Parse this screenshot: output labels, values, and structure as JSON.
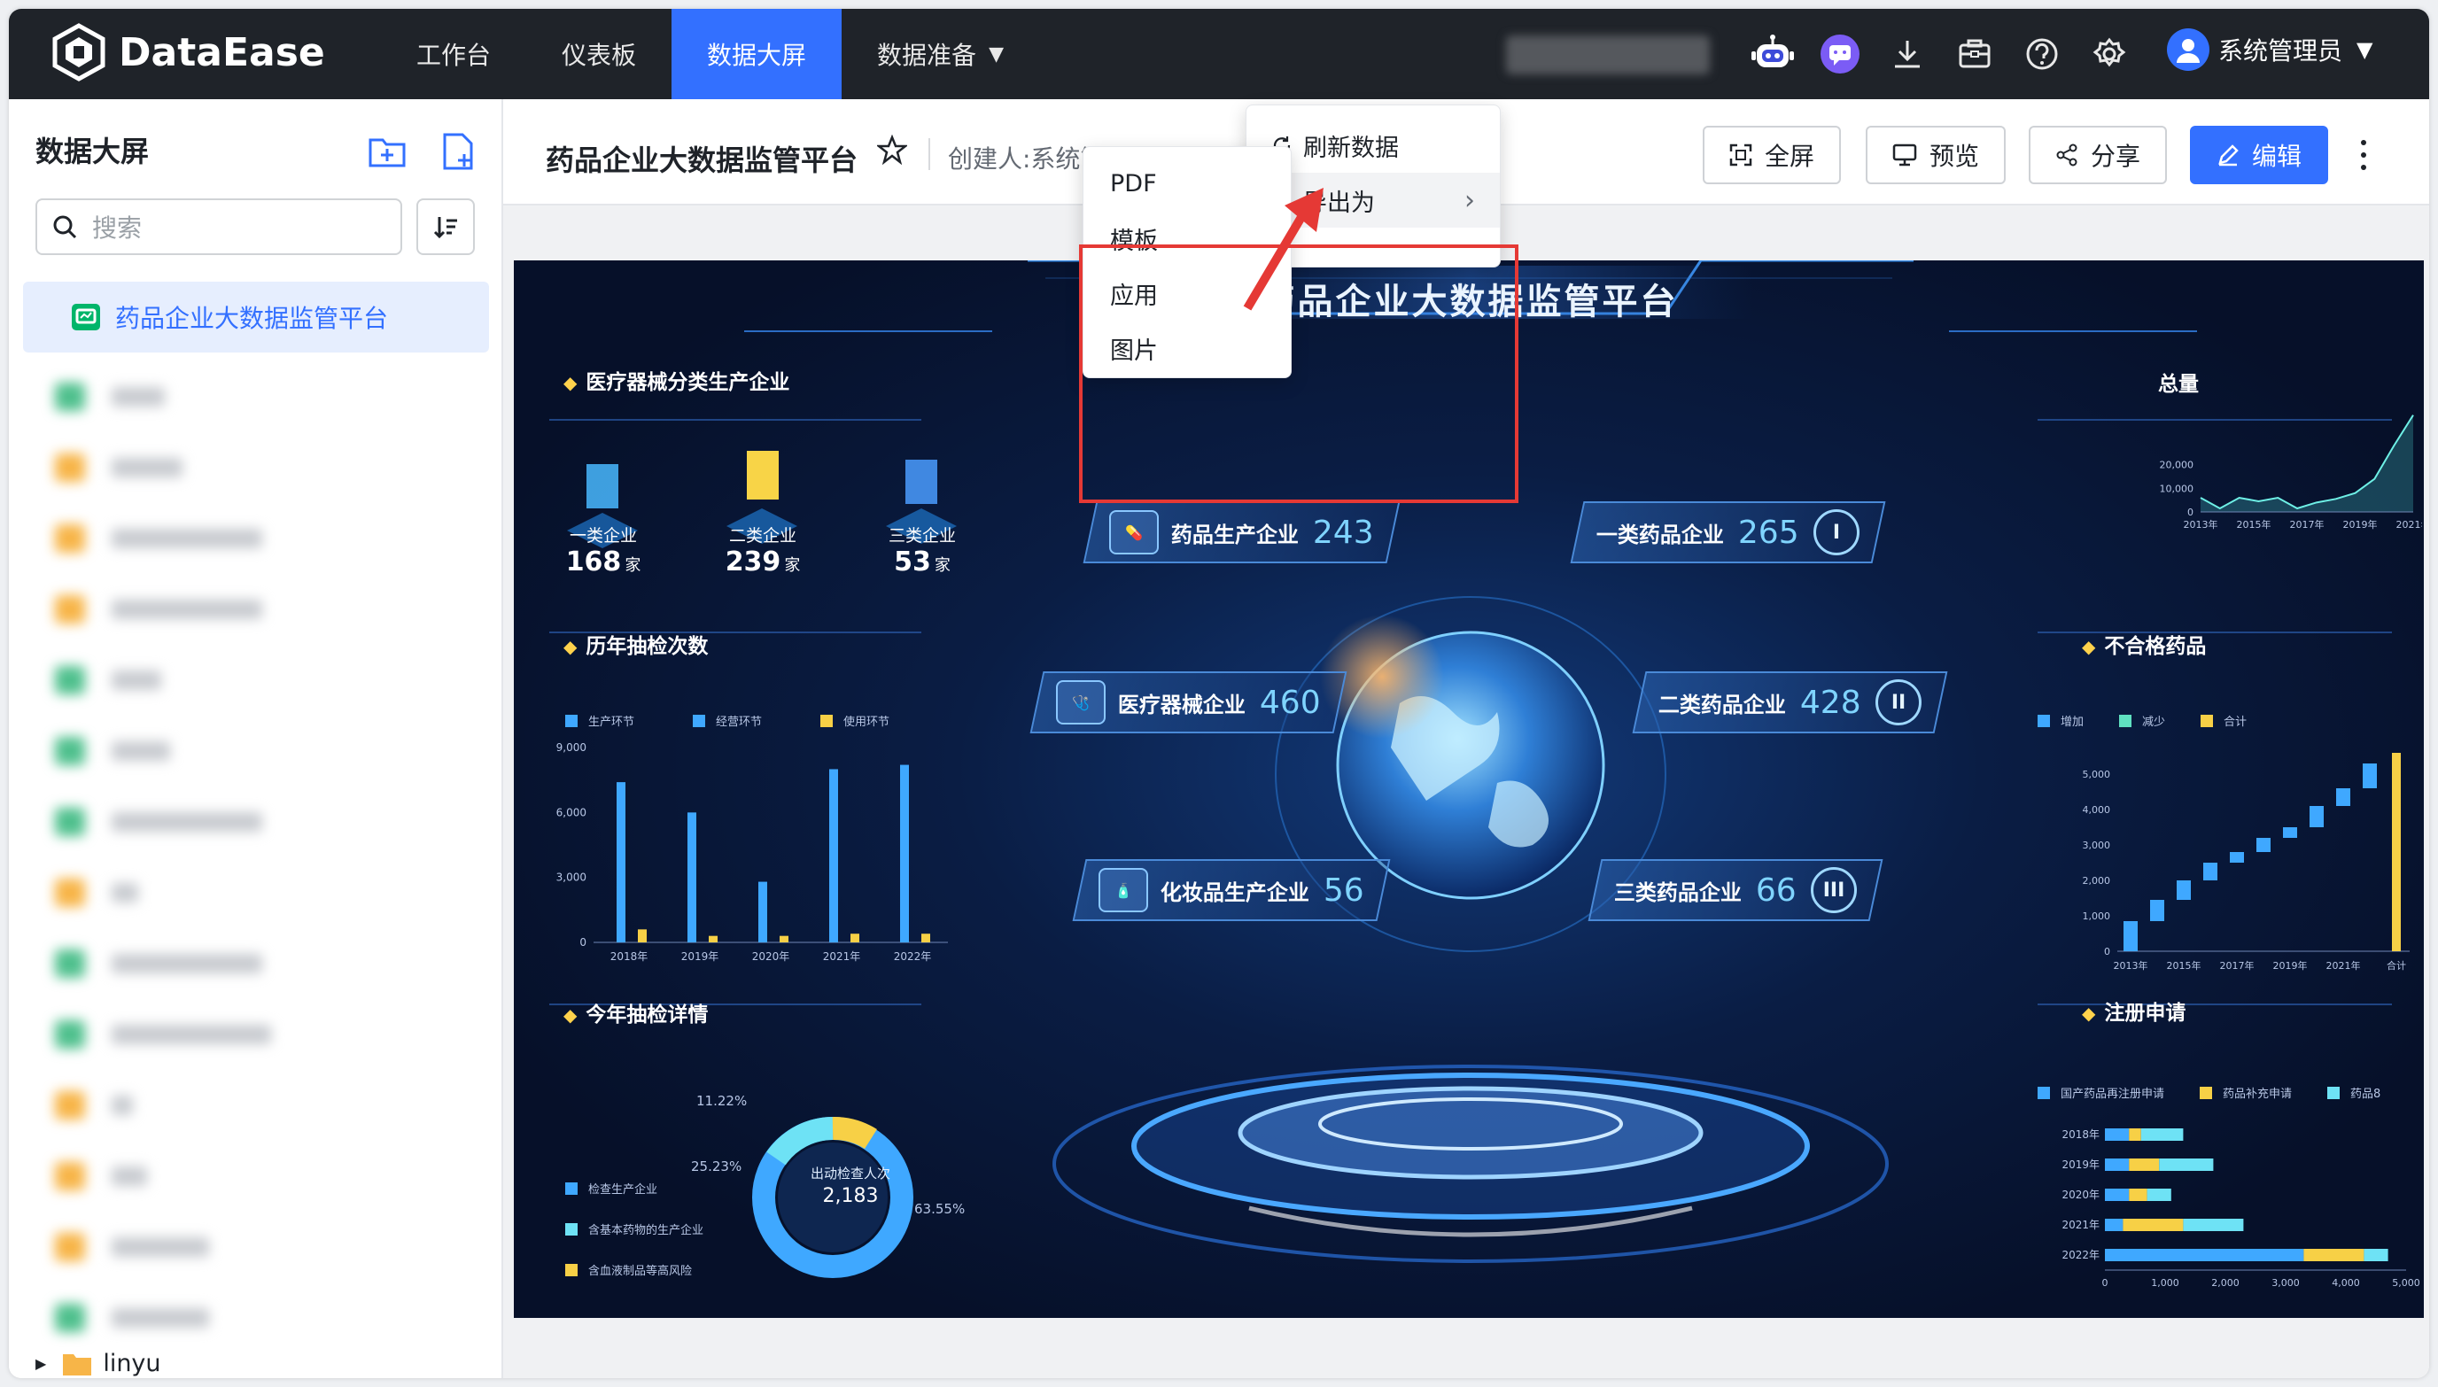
{
  "app": {
    "name": "DataEase"
  },
  "nav": [
    {
      "label": "工作台",
      "active": false
    },
    {
      "label": "仪表板",
      "active": false
    },
    {
      "label": "数据大屏",
      "active": true
    },
    {
      "label": "数据准备",
      "active": false,
      "caret": "▼"
    }
  ],
  "top_icons": [
    "robot-icon",
    "chat-icon",
    "download-icon",
    "template-icon",
    "help-icon",
    "settings-icon"
  ],
  "user": {
    "name": "系统管理员",
    "caret": "▼"
  },
  "sidebar": {
    "title": "数据大屏",
    "search_placeholder": "搜索",
    "active_item": "药品企业大数据监管平台",
    "last_item": "linyu"
  },
  "header": {
    "title": "药品企业大数据监管平台",
    "creator": "创建人:系统管理员",
    "buttons": {
      "fullscreen": "全屏",
      "preview": "预览",
      "share": "分享",
      "edit": "编辑"
    }
  },
  "more_menu": {
    "refresh": "刷新数据",
    "export": "导出为",
    "export_arrow": "›"
  },
  "export_submenu": [
    "PDF",
    "模板",
    "应用",
    "图片"
  ],
  "colors": {
    "accent": "#3370ff",
    "topbar": "#1f2329",
    "highlight": "#e53935"
  },
  "dashboard": {
    "title": "药品企业大数据监管平台",
    "sections": {
      "device": "医疗器械分类生产企业",
      "yearly": "历年抽检次数",
      "detail": "今年抽检详情",
      "total": "总量",
      "unqualified": "不合格药品",
      "register": "注册申请"
    },
    "enterprise_classes": [
      {
        "label": "一类企业",
        "count": "168",
        "unit": "家"
      },
      {
        "label": "二类企业",
        "count": "239",
        "unit": "家"
      },
      {
        "label": "三类企业",
        "count": "53",
        "unit": "家"
      }
    ],
    "kpis": [
      {
        "label": "药品生产企业",
        "value": "243"
      },
      {
        "label": "一类药品企业",
        "value": "265",
        "badge": "I"
      },
      {
        "label": "医疗器械企业",
        "value": "460"
      },
      {
        "label": "二类药品企业",
        "value": "428",
        "badge": "II"
      },
      {
        "label": "化妆品生产企业",
        "value": "56"
      },
      {
        "label": "三类药品企业",
        "value": "66",
        "badge": "III"
      }
    ],
    "donut": {
      "center_label": "出动检查人次",
      "center_value": "2,183",
      "pct_labels": [
        "11.22%",
        "25.23%",
        "63.55%"
      ],
      "legend": [
        "检查生产企业",
        "含基本药物的生产企业",
        "含血液制品等高风险"
      ]
    }
  },
  "chart_data": [
    {
      "type": "bar",
      "title": "历年抽检次数",
      "categories": [
        "2018年",
        "2019年",
        "2020年",
        "2021年",
        "2022年"
      ],
      "series": [
        {
          "name": "生产环节",
          "values": [
            7400,
            6000,
            2800,
            8000,
            8200
          ]
        },
        {
          "name": "经营环节",
          "values": [
            0,
            0,
            0,
            0,
            0
          ]
        },
        {
          "name": "使用环节",
          "values": [
            600,
            300,
            300,
            400,
            400
          ]
        }
      ],
      "yticks": [
        "9,000",
        "6,000",
        "3,000",
        "0"
      ],
      "ylim": [
        0,
        9000
      ]
    },
    {
      "type": "area",
      "title": "总量",
      "x": [
        "2013年",
        "2015年",
        "2017年",
        "2019年",
        "2021年"
      ],
      "values": [
        6000,
        1500,
        6000,
        4500,
        6000,
        1500,
        4000,
        5500,
        8000,
        14000,
        28000,
        41000
      ],
      "yticks": [
        "20,000",
        "10,000",
        "0"
      ],
      "ylim": [
        0,
        45000
      ]
    },
    {
      "type": "bar",
      "title": "不合格药品",
      "categories": [
        "2013年",
        "2014年",
        "2015年",
        "2016年",
        "2017年",
        "2018年",
        "2019年",
        "2020年",
        "2021年",
        "2022年",
        "合计"
      ],
      "xticks": [
        "2013年",
        "2015年",
        "2017年",
        "2019年",
        "2021年",
        "合计"
      ],
      "series": [
        {
          "name": "增加",
          "values": [
            850,
            1450,
            2000,
            2500,
            2800,
            3200,
            3500,
            4100,
            4600,
            5300,
            5600
          ]
        },
        {
          "name": "减少",
          "values": [
            0,
            0,
            0,
            0,
            0,
            0,
            0,
            0,
            0,
            0,
            0
          ]
        },
        {
          "name": "合计",
          "values": [
            0,
            0,
            0,
            0,
            0,
            0,
            0,
            0,
            0,
            0,
            5600
          ]
        }
      ],
      "yticks": [
        "5,000",
        "4,000",
        "3,000",
        "2,000",
        "1,000",
        "0"
      ],
      "ylim": [
        0,
        6000
      ]
    },
    {
      "type": "bar",
      "title": "注册申请",
      "orientation": "horizontal",
      "categories": [
        "2018年",
        "2019年",
        "2020年",
        "2021年",
        "2022年"
      ],
      "series": [
        {
          "name": "国产药品再注册申请",
          "values": [
            400,
            400,
            400,
            300,
            3300
          ]
        },
        {
          "name": "药品补充申请",
          "values": [
            200,
            500,
            300,
            1000,
            1000
          ]
        },
        {
          "name": "药品8",
          "values": [
            700,
            900,
            400,
            1000,
            400
          ]
        }
      ],
      "xticks": [
        "0",
        "1,000",
        "2,000",
        "3,000",
        "4,000",
        "5,000"
      ],
      "xlim": [
        0,
        5000
      ]
    }
  ]
}
